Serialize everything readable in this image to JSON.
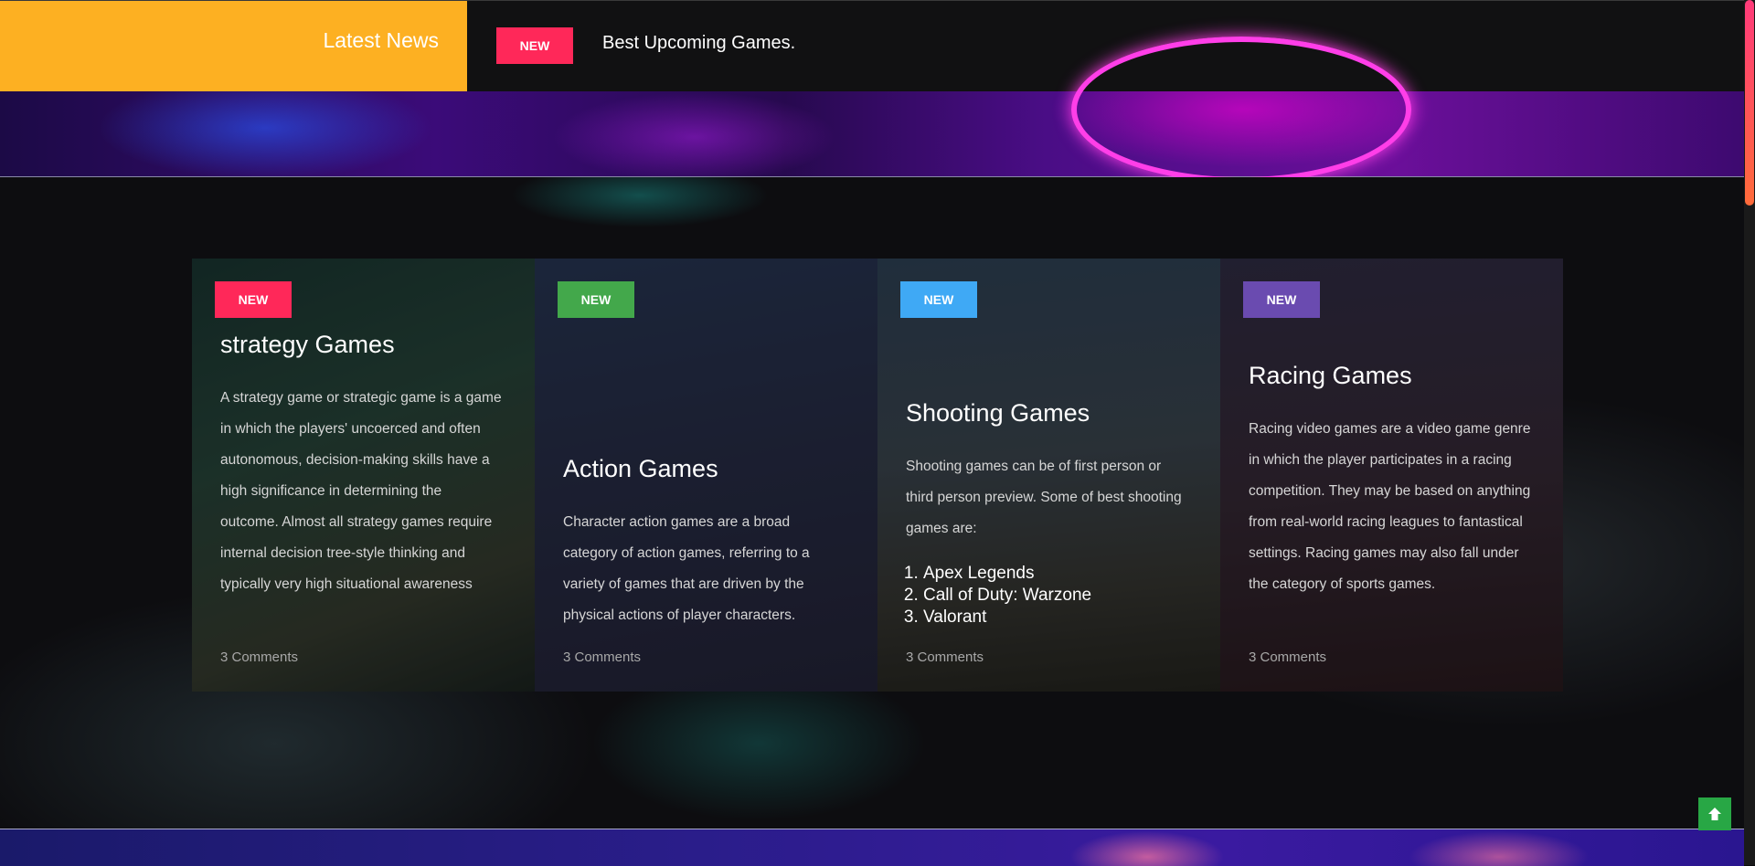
{
  "ticker": {
    "label": "Latest News",
    "badge": "NEW",
    "headline": "Best Upcoming Games."
  },
  "colors": {
    "ticker_label_bg": "#fdb022",
    "badge_red": "#ff2859",
    "badge_green": "#43a84b",
    "badge_blue": "#3fa9f5",
    "badge_purple": "#6a4bb0",
    "to_top_green": "#28a745"
  },
  "cards": [
    {
      "badge": "NEW",
      "badge_color": "#ff2859",
      "title": "strategy Games",
      "description": "A strategy game or strategic game is a game in which the players' uncoerced and often autonomous, decision-making skills have a high significance in determining the outcome. Almost all strategy games require internal decision tree-style thinking and typically very high situational awareness",
      "comments": "3 Comments"
    },
    {
      "badge": "NEW",
      "badge_color": "#43a84b",
      "title": "Action Games",
      "description": "Character action games are a broad category of action games, referring to a variety of games that are driven by the physical actions of player characters.",
      "comments": "3 Comments"
    },
    {
      "badge": "NEW",
      "badge_color": "#3fa9f5",
      "title": "Shooting Games",
      "description": "Shooting games can be of first person or third person preview. Some of best shooting games are:",
      "list": [
        "Apex Legends",
        "Call of Duty: Warzone",
        "Valorant"
      ],
      "comments": "3 Comments"
    },
    {
      "badge": "NEW",
      "badge_color": "#6a4bb0",
      "title": "Racing Games",
      "description": "Racing video games are a video game genre in which the player participates in a racing competition. They may be based on anything from real-world racing leagues to fantastical settings. Racing games may also fall under the category of sports games.",
      "comments": "3 Comments"
    }
  ],
  "icons": {
    "back_to_top": "arrow-up-icon"
  }
}
